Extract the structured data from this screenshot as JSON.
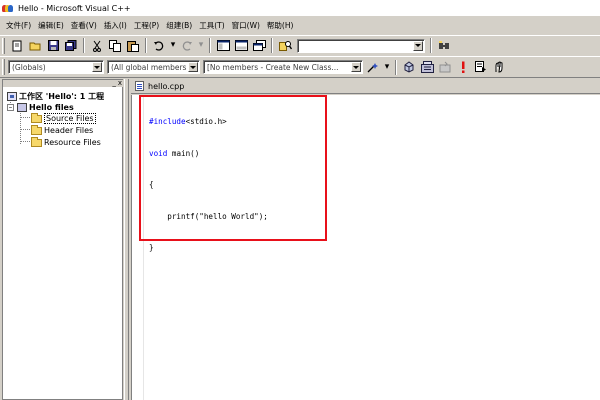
{
  "window": {
    "title": "Hello - Microsoft Visual C++",
    "icon": "visual-cpp-logo-icon"
  },
  "menu": [
    "文件(F)",
    "编辑(E)",
    "查看(V)",
    "插入(I)",
    "工程(P)",
    "组建(B)",
    "工具(T)",
    "窗口(W)",
    "帮助(H)"
  ],
  "toolbar1": {
    "icons": [
      "new-file-icon",
      "open-folder-icon",
      "save-icon",
      "save-all-icon",
      "cut-icon",
      "copy-icon",
      "paste-icon",
      "undo-icon",
      "redo-icon",
      "workspace-icon",
      "output-icon",
      "window-list-icon",
      "find-in-files-icon",
      "find-icon"
    ],
    "find_combo_value": ""
  },
  "toolbar2": {
    "scope_combo": "(Globals)",
    "members_combo": "(All global members",
    "function_combo": "[No members - Create New Class...",
    "icons": [
      "wizard-action-icon",
      "compile-icon",
      "build-icon",
      "stop-build-icon",
      "execute-icon",
      "go-icon",
      "insert-breakpoint-icon"
    ]
  },
  "workspace": {
    "controls": [
      "_",
      "x"
    ],
    "root": "工作区 'Hello': 1 工程",
    "project": "Hello files",
    "folders": [
      "Source Files",
      "Header Files",
      "Resource Files"
    ],
    "selected_folder": "Source Files"
  },
  "editor": {
    "tab_title": "hello.cpp",
    "code_lines": [
      {
        "kw": "#include",
        "rest": "<stdio.h>"
      },
      {
        "kw": "void",
        "rest": " main()"
      },
      {
        "kw": "",
        "rest": "{"
      },
      {
        "kw": "",
        "rest": "    printf(\"hello World\");"
      },
      {
        "kw": "",
        "rest": "}"
      }
    ]
  },
  "colors": {
    "highlight_box": "#e8101a",
    "keyword": "#0000ff",
    "chrome": "#d4d0c8"
  }
}
